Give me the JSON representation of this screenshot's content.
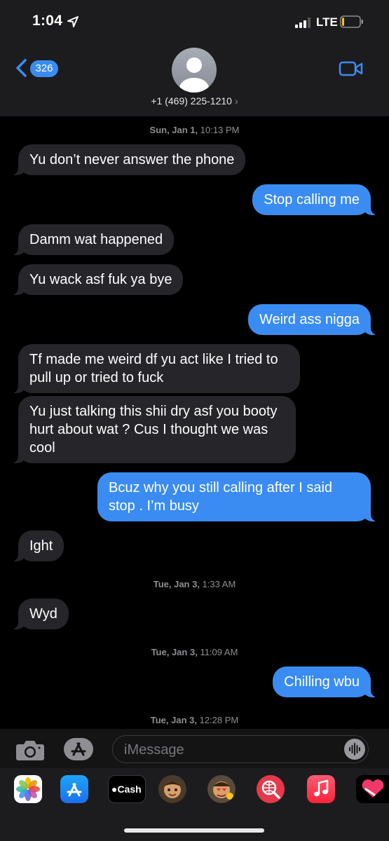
{
  "status_bar": {
    "time": "1:04",
    "network": "LTE",
    "battery_level": 0.12,
    "battery_color": "#f5c518"
  },
  "header": {
    "back_count": "326",
    "contact": "+1 (469) 225-1210",
    "accent": "#3a8cf3"
  },
  "timestamps": {
    "t1_day": "Sun, Jan 1,",
    "t1_time": "10:13 PM",
    "t2_day": "Tue, Jan 3,",
    "t2_time": "1:33 AM",
    "t3_day": "Tue, Jan 3,",
    "t3_time": "11:09 AM",
    "t4_day": "Tue, Jan 3,",
    "t4_time": "12:28 PM"
  },
  "messages": [
    {
      "dir": "in",
      "text": "Yu don’t never answer the phone"
    },
    {
      "dir": "out",
      "text": "Stop calling me"
    },
    {
      "dir": "in",
      "text": "Damm wat happened"
    },
    {
      "dir": "in",
      "text": "Yu wack asf fuk ya bye"
    },
    {
      "dir": "out",
      "text": "Weird ass nigga"
    },
    {
      "dir": "in",
      "text": "Tf made me weird df yu act like I tried to pull up or tried to fuck"
    },
    {
      "dir": "in",
      "text": "Yu just talking this shii dry asf you booty hurt about wat ? Cus I thought we was cool"
    },
    {
      "dir": "out",
      "text": "Bcuz why you still calling after I said stop . I’m busy"
    },
    {
      "dir": "in",
      "text": "Ight"
    },
    {
      "dir": "in",
      "text": "Wyd"
    },
    {
      "dir": "out",
      "text": "Chilling wbu"
    }
  ],
  "input": {
    "placeholder": "iMessage"
  },
  "drawer": {
    "cash_label": "Cash",
    "apps": [
      "photos-icon",
      "app-store-icon",
      "apple-cash-icon",
      "memoji-icon",
      "memoji-stickers-icon",
      "web-search-icon",
      "music-icon",
      "digital-touch-icon"
    ]
  }
}
